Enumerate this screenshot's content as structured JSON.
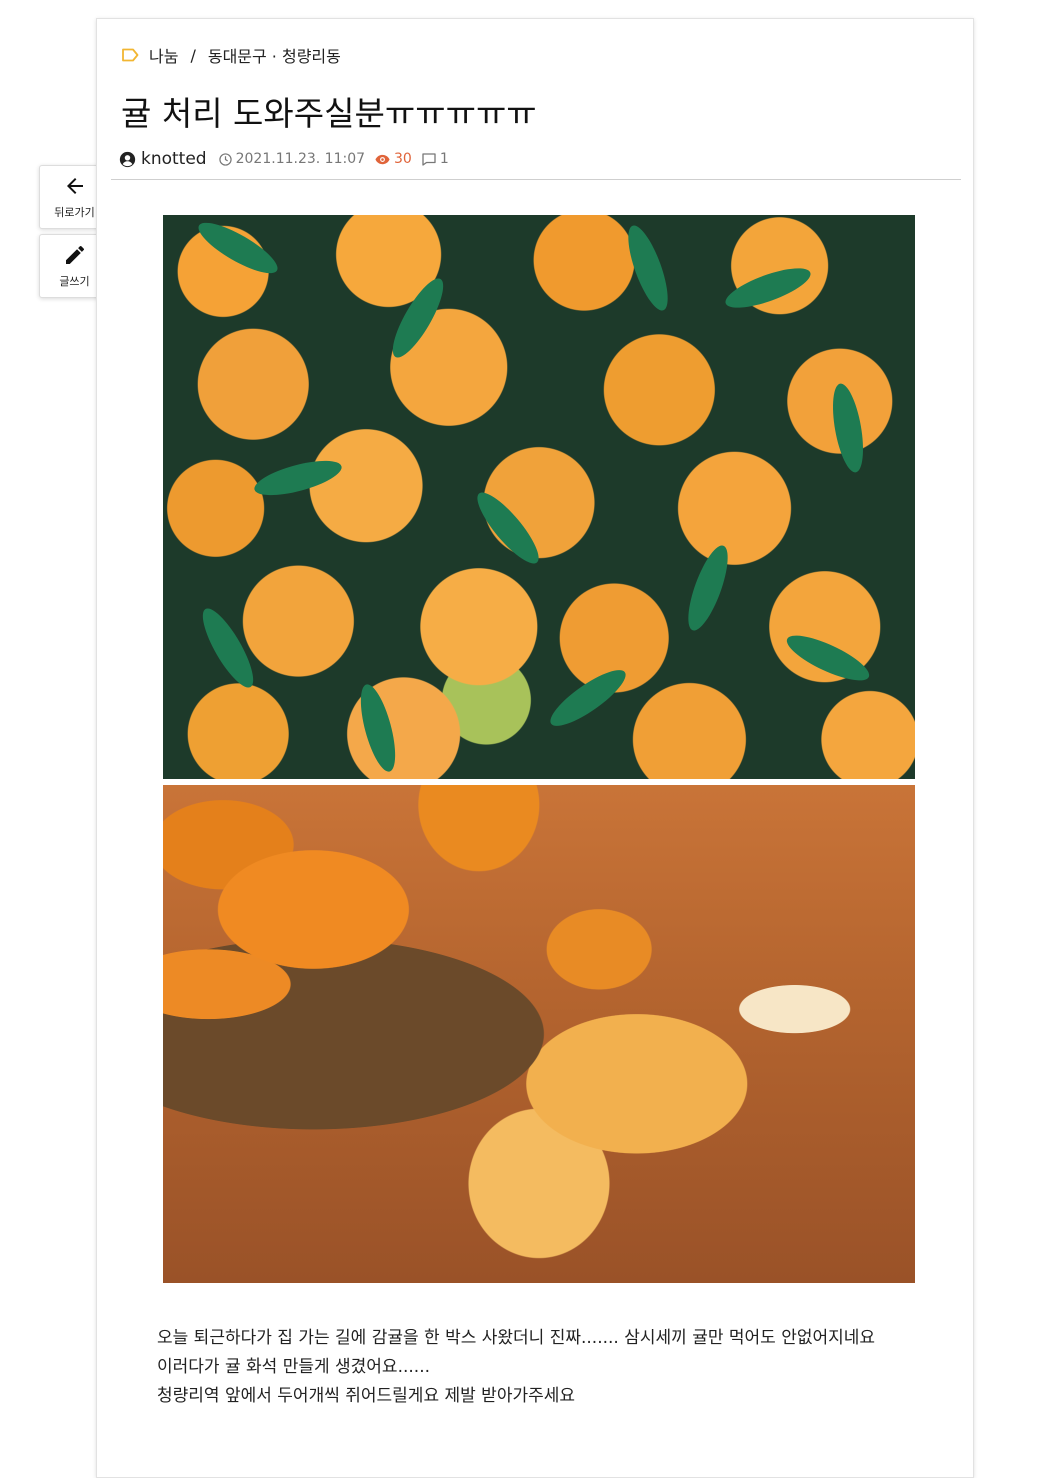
{
  "breadcrumb": {
    "category": "나눔",
    "separator": "/",
    "location": "동대문구 · 청량리동"
  },
  "post": {
    "title": "귤 처리 도와주실분ㅠㅠㅠㅠㅠ",
    "author": "knotted",
    "datetime": "2021.11.23. 11:07",
    "views": "30",
    "comments": "1",
    "body": [
      "오늘 퇴근하다가 집 가는 길에 감귤을 한 박스 사왔더니 진짜....... 삼시세끼 귤만 먹어도 안없어지네요",
      "이러다가 귤 화석 만들게 생겼어요......",
      "청량리역 앞에서 두어개씩 쥐어드릴게요 제발 받아가주세요"
    ]
  },
  "side_actions": {
    "back_label": "뒤로가기",
    "write_label": "글쓰기"
  },
  "icons": {
    "category": "tag-outline-icon",
    "author": "user-circle-icon",
    "time": "clock-icon",
    "views": "eye-icon",
    "comments": "comment-icon",
    "back": "arrow-left-icon",
    "write": "pencil-icon"
  },
  "colors": {
    "tag_accent": "#f2b632",
    "views_accent": "#e0643a"
  }
}
